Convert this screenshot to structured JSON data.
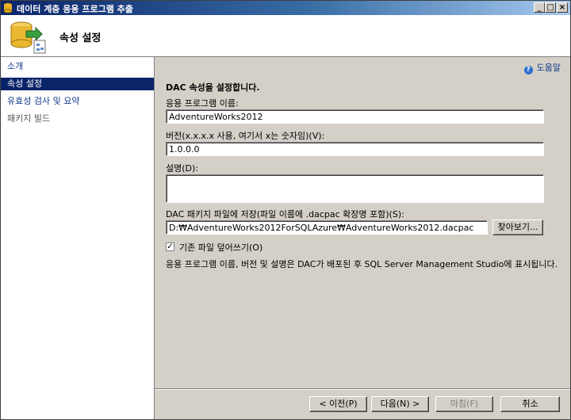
{
  "window": {
    "title": "데이터 계층 응용 프로그램 추출"
  },
  "header": {
    "title": "속성 설정"
  },
  "nav": {
    "items": [
      {
        "label": "소개"
      },
      {
        "label": "속성 설정"
      },
      {
        "label": "유효성 검사 및 요약"
      },
      {
        "label": "패키지 빌드"
      }
    ]
  },
  "help": {
    "label": "도움말"
  },
  "form": {
    "heading": "DAC 속성을 설정합니다.",
    "app_name_label": "응용 프로그램 이름:",
    "app_name_value": "AdventureWorks2012",
    "version_label": "버전(x.x.x.x 사용, 여기서 x는 숫자임)(V):",
    "version_value": "1.0.0.0",
    "description_label": "설명(D):",
    "description_value": "",
    "save_label": "DAC 패키지 파일에 저장(파일 이름에 .dacpac 확장명 포함)(S):",
    "save_value": "D:₩AdventureWorks2012ForSQLAzure₩AdventureWorks2012.dacpac",
    "browse_label": "찾아보기...",
    "overwrite_label": "기존 파일 덮어쓰기(O)",
    "overwrite_checked": true,
    "info_text": "응용 프로그램 이름, 버전 및 설명은 DAC가 배포된 후 SQL Server Management Studio에 표시됩니다."
  },
  "footer": {
    "prev_label": "< 이전(P)",
    "next_label": "다음(N) >",
    "finish_label": "마침(F)",
    "cancel_label": "취소"
  }
}
